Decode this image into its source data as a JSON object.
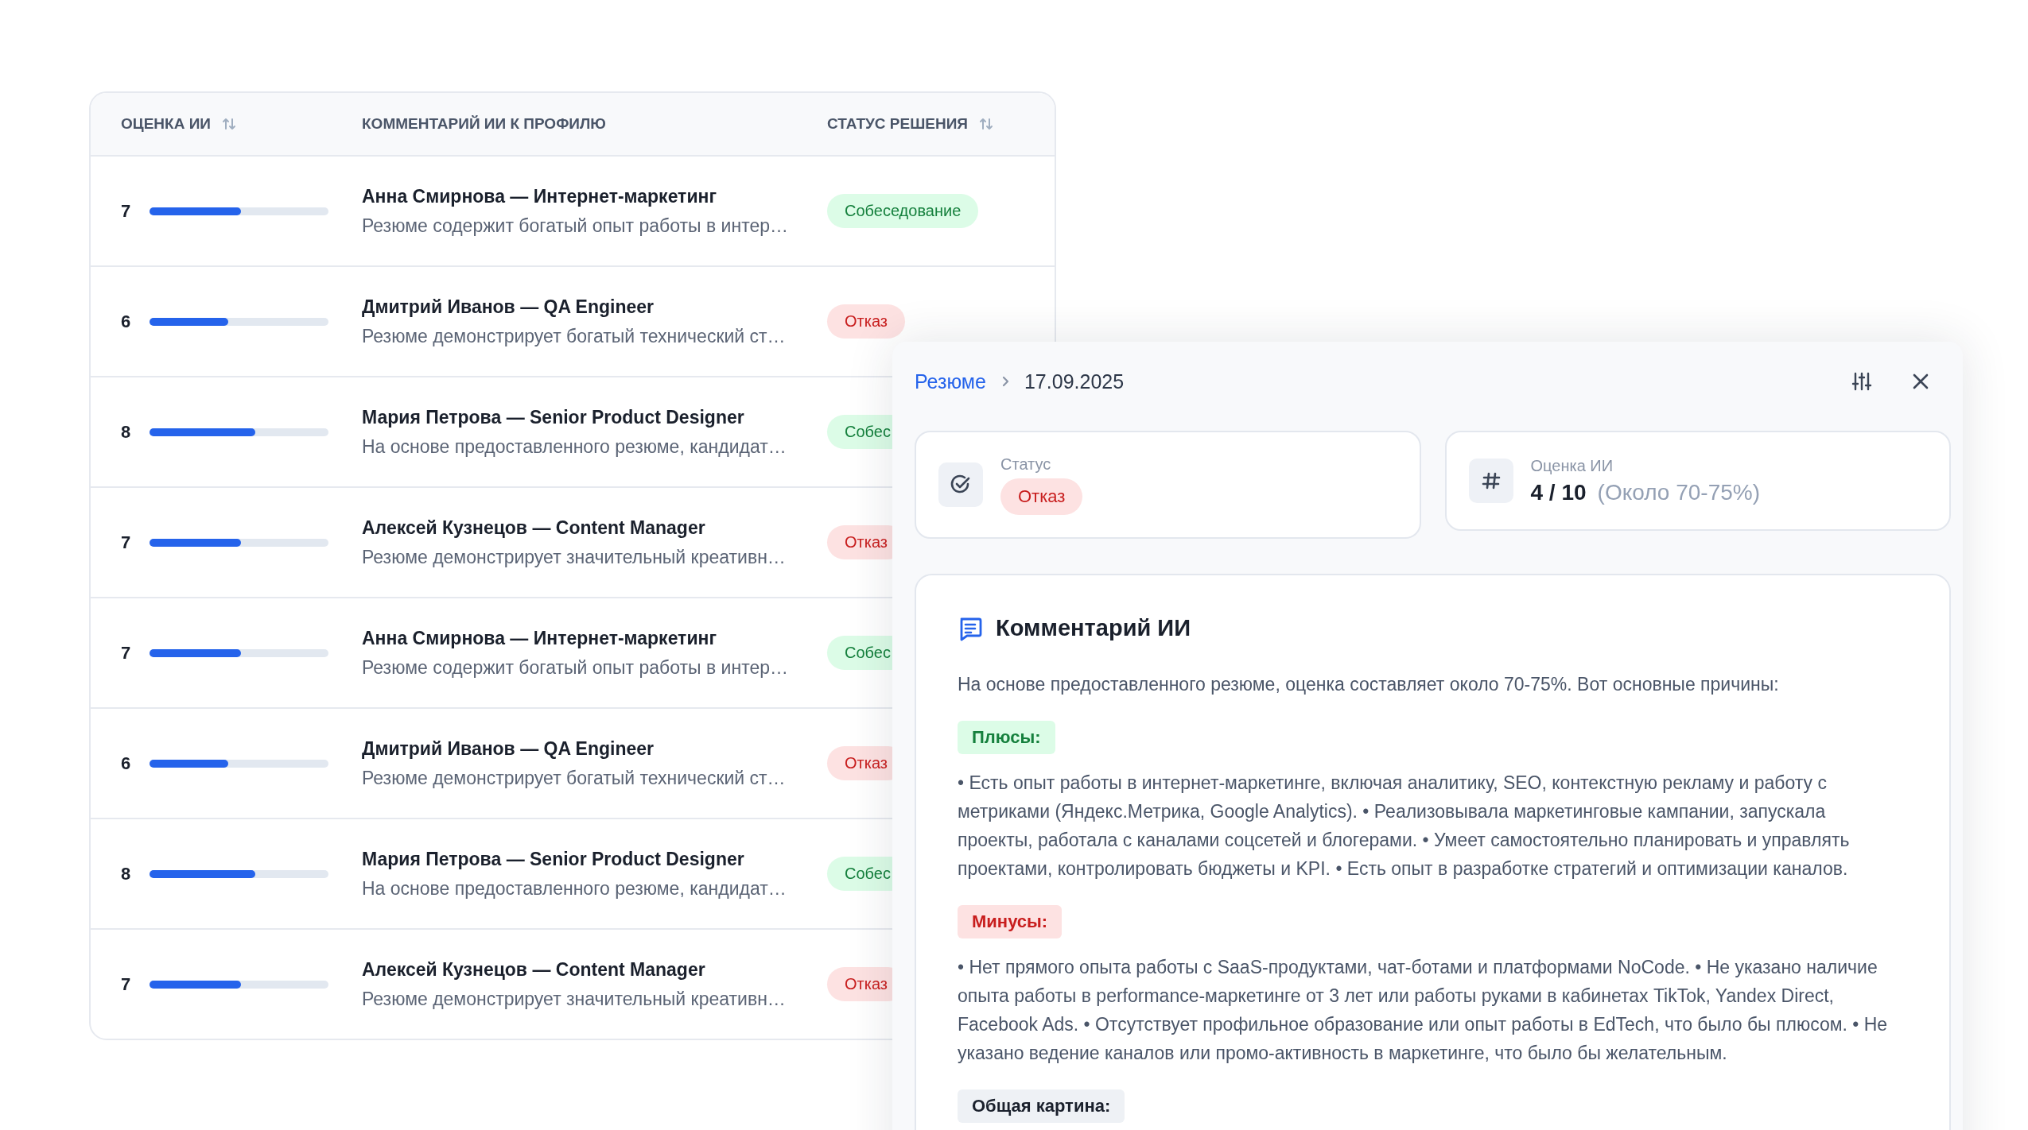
{
  "table": {
    "columns": [
      {
        "label": "ОЦЕНКА ИИ",
        "sortable": true
      },
      {
        "label": "КОММЕНТАРИЙ ИИ К ПРОФИЛЮ",
        "sortable": false
      },
      {
        "label": "СТАТУС РЕШЕНИЯ",
        "sortable": true
      }
    ],
    "rows": [
      {
        "score": "7",
        "level": 0.51,
        "title": "Анна Смирнова — Интернет-маркетинг",
        "comment": "Резюме содержит богатый опыт работы в интер…",
        "status": {
          "label": "Собеседование",
          "kind": "interview"
        }
      },
      {
        "score": "6",
        "level": 0.44,
        "title": "Дмитрий Иванов — QA Engineer",
        "comment": "Резюме демонстрирует богатый технический ст…",
        "status": {
          "label": "Отказ",
          "kind": "reject"
        }
      },
      {
        "score": "8",
        "level": 0.59,
        "title": "Мария Петрова — Senior Product Designer",
        "comment": "На основе предоставленного резюме, кандидат…",
        "status": {
          "label": "Собес",
          "kind": "interview"
        }
      },
      {
        "score": "7",
        "level": 0.51,
        "title": "Алексей Кузнецов — Content Manager",
        "comment": "Резюме демонстрирует значительный креативн…",
        "status": {
          "label": "Отказ",
          "kind": "reject"
        }
      },
      {
        "score": "7",
        "level": 0.51,
        "title": "Анна Смирнова — Интернет-маркетинг",
        "comment": "Резюме содержит богатый опыт работы в интер…",
        "status": {
          "label": "Собес",
          "kind": "interview"
        }
      },
      {
        "score": "6",
        "level": 0.44,
        "title": "Дмитрий Иванов — QA Engineer",
        "comment": "Резюме демонстрирует богатый технический ст…",
        "status": {
          "label": "Отказ",
          "kind": "reject"
        }
      },
      {
        "score": "8",
        "level": 0.59,
        "title": "Мария Петрова — Senior Product Designer",
        "comment": "На основе предоставленного резюме, кандидат…",
        "status": {
          "label": "Собес",
          "kind": "interview"
        }
      },
      {
        "score": "7",
        "level": 0.51,
        "title": "Алексей Кузнецов — Content Manager",
        "comment": "Резюме демонстрирует значительный креативн…",
        "status": {
          "label": "Отказ",
          "kind": "reject"
        }
      }
    ]
  },
  "panel": {
    "breadcrumb": [
      {
        "label": "Резюме",
        "kind": "link"
      },
      {
        "label": "17.09.2025",
        "kind": "current"
      }
    ],
    "status_card": {
      "label": "Статус",
      "value": "Отказ",
      "kind": "reject"
    },
    "score_card": {
      "label": "Оценка ИИ",
      "value": "4 / 10",
      "note": "(Около 70-75%)"
    },
    "comment": {
      "title": "Комментарий ИИ",
      "intro": "На основе предоставленного резюме, оценка составляет около 70-75%. Вот основные причины:",
      "sections": [
        {
          "kind": "pros",
          "label": "Плюсы:",
          "text": "• Есть опыт работы в интернет-маркетинге, включая аналитику, SEO, контекстную рекламу и работу с метриками (Яндекс.Метрика, Google Analytics). • Реализовывала маркетинговые кампании, запускала проекты, работала с каналами соцсетей и блогерами. • Умеет самостоятельно планировать и управлять проектами, контролировать бюджеты и KPI. • Есть опыт в разработке стратегий и оптимизации каналов."
        },
        {
          "kind": "cons",
          "label": "Минусы:",
          "text": "• Нет прямого опыта работы с SaaS-продуктами, чат-ботами и платформами NoCode. • Не указано наличие опыта работы в performance-маркетинге от 3 лет или работы руками в кабинетах TikTok, Yandex Direct, Facebook Ads. • Отсутствует профильное образование или опыт работы в EdTech, что было бы плюсом. • Не указано ведение каналов или промо-активность в маркетинге, что было бы желательным."
        },
        {
          "kind": "summary",
          "label": "Общая картина:"
        }
      ]
    }
  }
}
